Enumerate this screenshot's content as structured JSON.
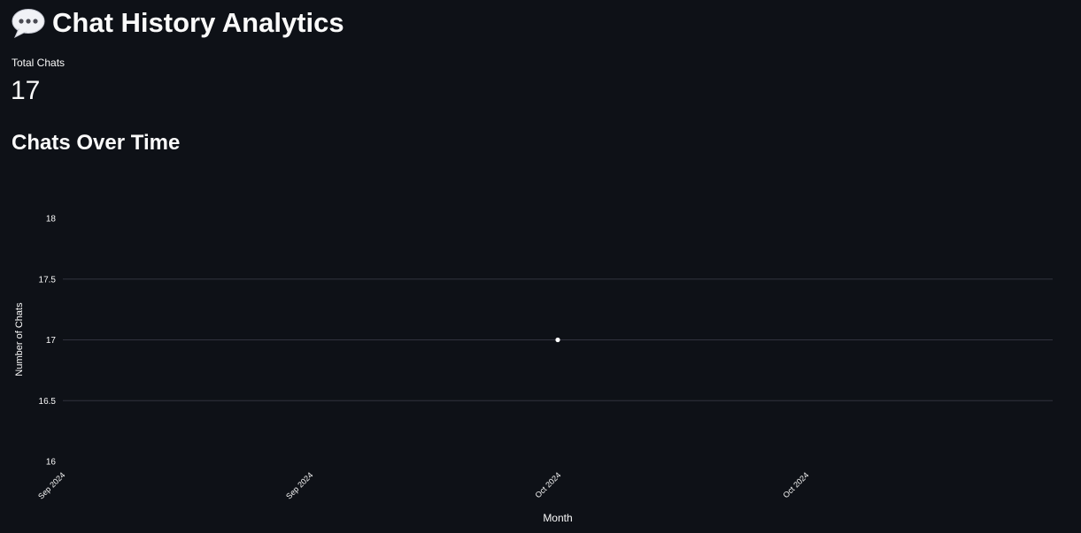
{
  "header": {
    "title": "Chat History Analytics",
    "icon": "speech-bubble-icon"
  },
  "metrics": {
    "total_chats_label": "Total Chats",
    "total_chats_value": "17"
  },
  "section": {
    "title": "Chats Over Time"
  },
  "colors": {
    "background": "#0e1117",
    "text": "#fafafa",
    "gridline": "#31333f",
    "point": "#ffffff"
  },
  "chart_data": {
    "type": "line",
    "title": "",
    "xlabel": "Month",
    "ylabel": "Number of Chats",
    "x_tick_labels": [
      "Sep 2024",
      "Sep 2024",
      "Oct 2024",
      "Oct 2024"
    ],
    "y_tick_labels": [
      "16",
      "16.5",
      "17",
      "17.5",
      "18"
    ],
    "ylim": [
      16,
      18
    ],
    "grid": true,
    "series": [
      {
        "points": [
          {
            "x": "Oct 2024",
            "y": 17
          }
        ]
      }
    ]
  }
}
